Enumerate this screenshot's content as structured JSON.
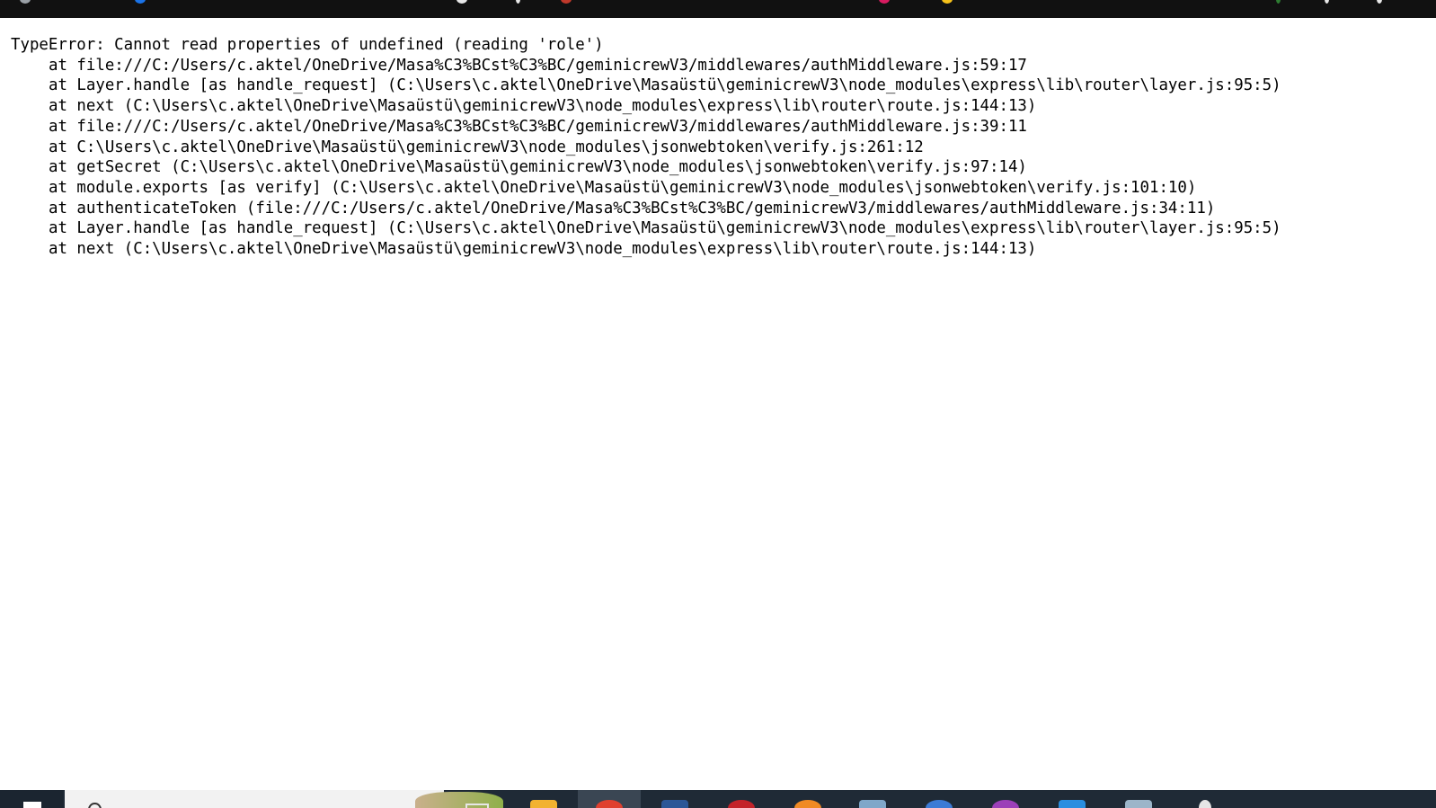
{
  "error": {
    "message": "TypeError: Cannot read properties of undefined (reading 'role')",
    "frames": [
      "at file:///C:/Users/c.aktel/OneDrive/Masa%C3%BCst%C3%BC/geminicrewV3/middlewares/authMiddleware.js:59:17",
      "at Layer.handle [as handle_request] (C:\\Users\\c.aktel\\OneDrive\\Masaüstü\\geminicrewV3\\node_modules\\express\\lib\\router\\layer.js:95:5)",
      "at next (C:\\Users\\c.aktel\\OneDrive\\Masaüstü\\geminicrewV3\\node_modules\\express\\lib\\router\\route.js:144:13)",
      "at file:///C:/Users/c.aktel/OneDrive/Masa%C3%BCst%C3%BC/geminicrewV3/middlewares/authMiddleware.js:39:11",
      "at C:\\Users\\c.aktel\\OneDrive\\Masaüstü\\geminicrewV3\\node_modules\\jsonwebtoken\\verify.js:261:12",
      "at getSecret (C:\\Users\\c.aktel\\OneDrive\\Masaüstü\\geminicrewV3\\node_modules\\jsonwebtoken\\verify.js:97:14)",
      "at module.exports [as verify] (C:\\Users\\c.aktel\\OneDrive\\Masaüstü\\geminicrewV3\\node_modules\\jsonwebtoken\\verify.js:101:10)",
      "at authenticateToken (file:///C:/Users/c.aktel/OneDrive/Masa%C3%BCst%C3%BC/geminicrewV3/middlewares/authMiddleware.js:34:11)",
      "at Layer.handle [as handle_request] (C:\\Users\\c.aktel\\OneDrive\\Masaüstü\\geminicrewV3\\node_modules\\express\\lib\\router\\layer.js:95:5)",
      "at next (C:\\Users\\c.aktel\\OneDrive\\Masaüstü\\geminicrewV3\\node_modules\\express\\lib\\router\\route.js:144:13)"
    ]
  },
  "colors": {
    "page_background": "#ffffff",
    "text": "#000000",
    "browser_chrome": "#111111",
    "taskbar": "#1f2a36",
    "taskbar_active": "#3a4653"
  },
  "taskbar": {
    "start_icon": "windows-logo-icon",
    "search_icon": "search-icon",
    "task_view_icon": "task-view-icon",
    "apps": [
      {
        "icon": "file-explorer-icon",
        "color": "#f2b230",
        "active": false
      },
      {
        "icon": "chrome-icon",
        "color": "#e0402f",
        "active": true
      },
      {
        "icon": "word-icon",
        "color": "#2b5797",
        "active": false
      },
      {
        "icon": "red-app-icon",
        "color": "#c3232a",
        "active": false
      },
      {
        "icon": "firefox-icon",
        "color": "#f08a24",
        "active": false
      },
      {
        "icon": "photos-icon",
        "color": "#7fa7c9",
        "active": false
      },
      {
        "icon": "blue-circle-icon",
        "color": "#3c7bd6",
        "active": false
      },
      {
        "icon": "purple-circle-icon",
        "color": "#9c3fb8",
        "active": false
      },
      {
        "icon": "vscode-icon",
        "color": "#2a8ee0",
        "active": false
      },
      {
        "icon": "notepad-icon",
        "color": "#9cb5c9",
        "active": false
      },
      {
        "icon": "settings-icon",
        "color": "#e6e6e6",
        "active": false
      }
    ]
  }
}
